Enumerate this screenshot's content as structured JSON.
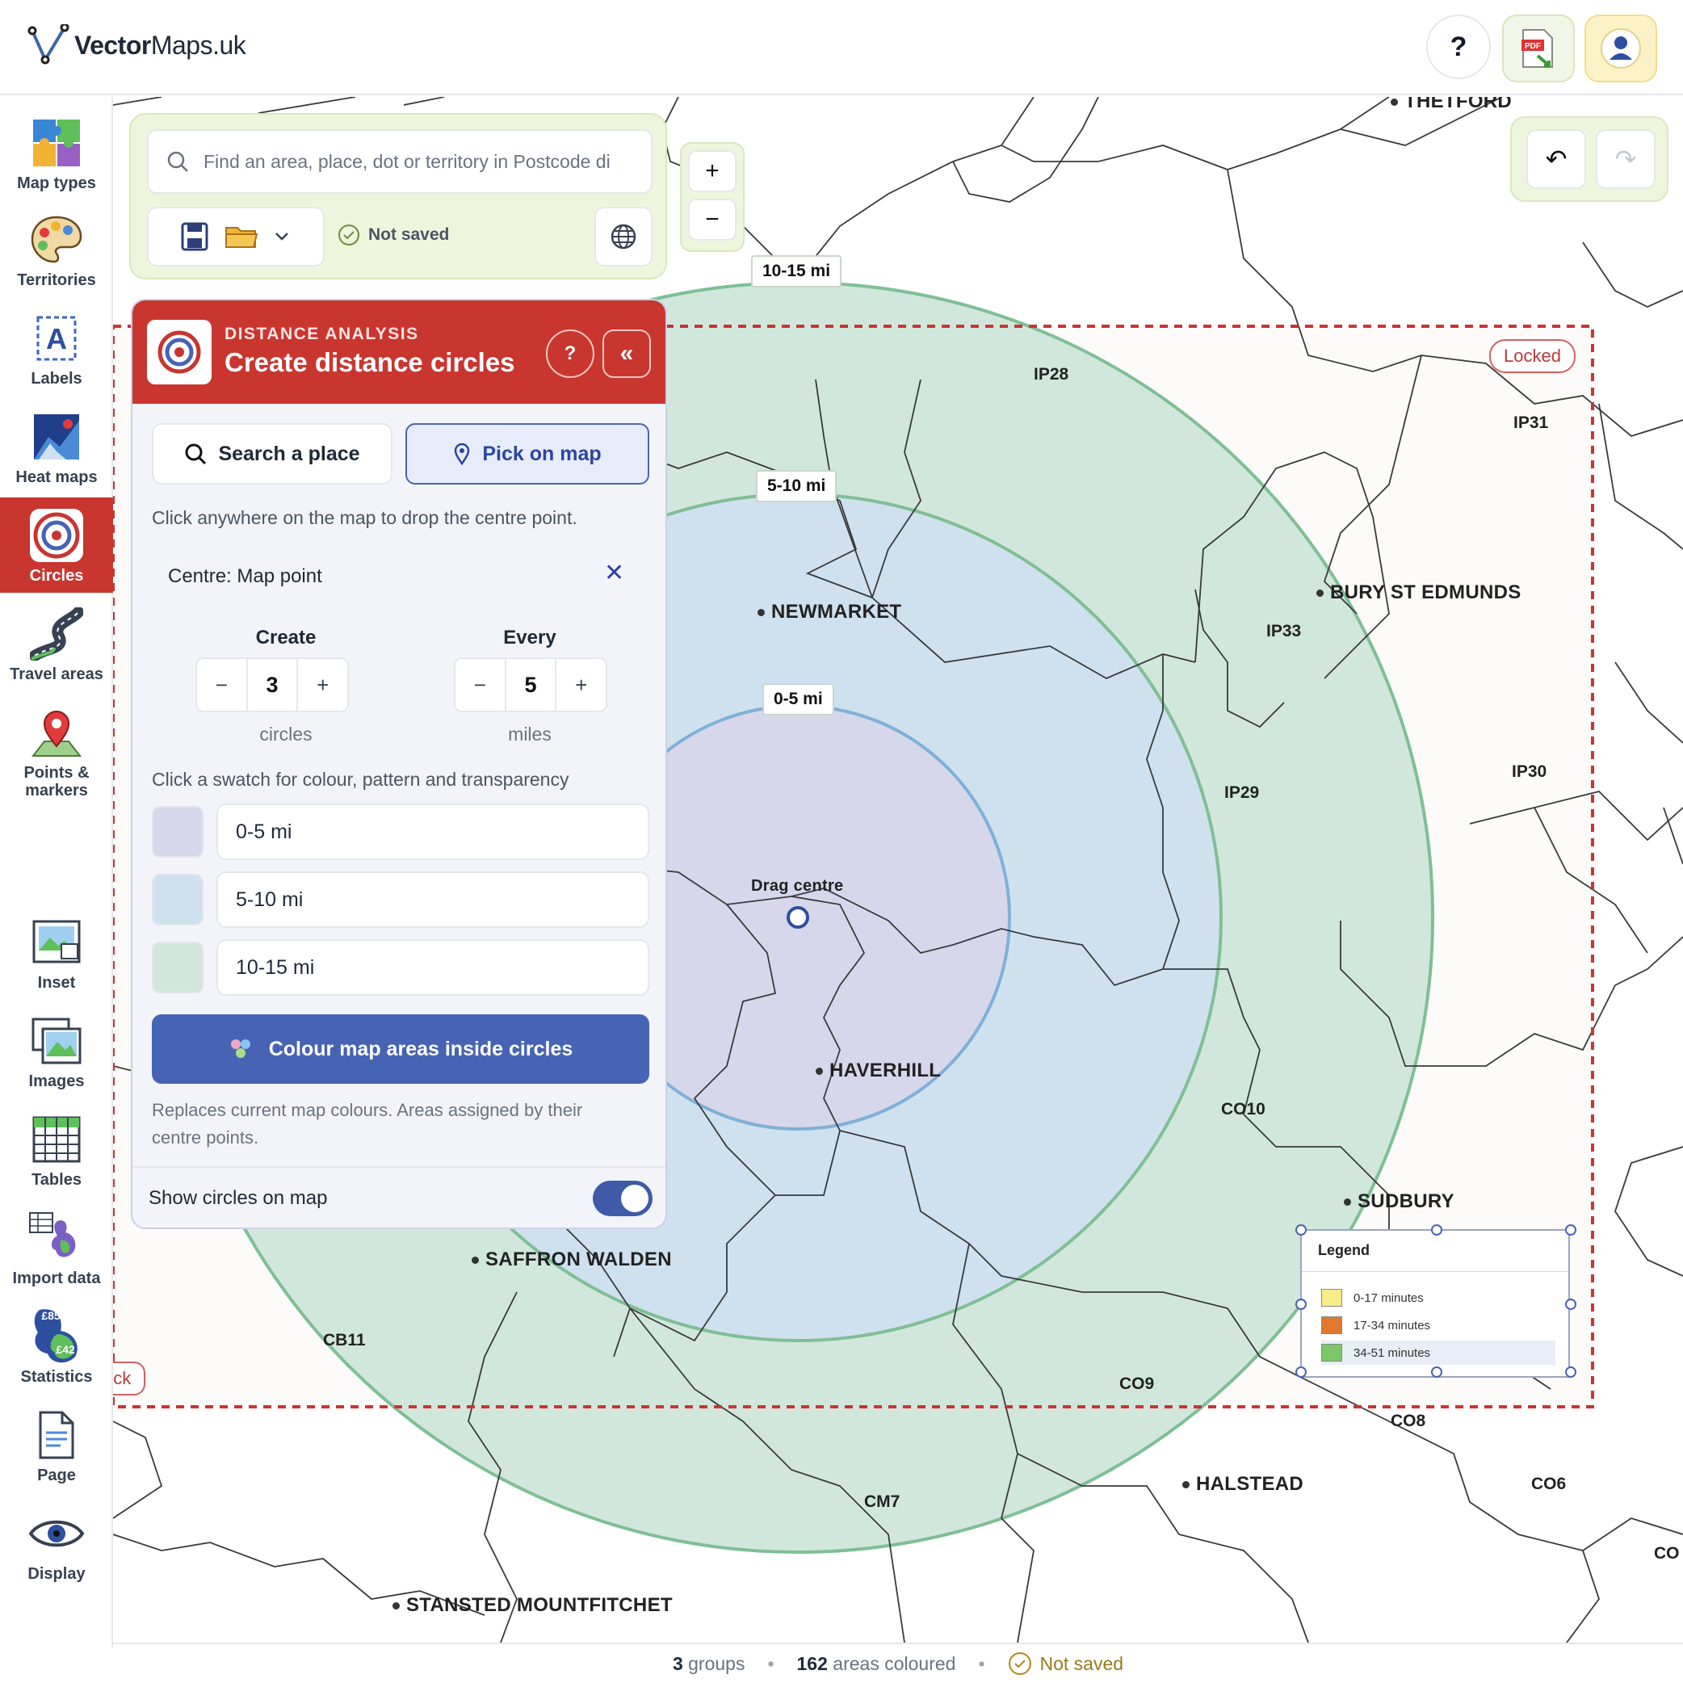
{
  "app": {
    "logo_text_bold": "Vector",
    "logo_text_rest": "Maps.uk",
    "help": "?"
  },
  "sidebar": {
    "items": [
      {
        "label": "Map types",
        "icon": "puzzle-icon"
      },
      {
        "label": "Territories",
        "icon": "palette-icon"
      },
      {
        "label": "Labels",
        "icon": "label-a-icon"
      },
      {
        "label": "Heat maps",
        "icon": "heat-map-icon"
      },
      {
        "label": "Circles",
        "icon": "target-icon",
        "active": true
      },
      {
        "label": "Travel areas",
        "icon": "road-icon"
      },
      {
        "label": "Points &",
        "label2": "markers",
        "icon": "map-pin-icon"
      },
      {
        "label": "Inset",
        "icon": "inset-icon"
      },
      {
        "label": "Images",
        "icon": "images-icon"
      },
      {
        "label": "Tables",
        "icon": "table-icon"
      },
      {
        "label": "Import data",
        "icon": "import-icon"
      },
      {
        "label": "Statistics",
        "icon": "statistics-icon",
        "badge1": "£85",
        "badge2": "£42"
      },
      {
        "label": "Page",
        "icon": "page-icon"
      },
      {
        "label": "Display",
        "icon": "eye-icon"
      }
    ]
  },
  "search": {
    "placeholder": "Find an area, place, dot or territory in Postcode di",
    "status": "Not saved"
  },
  "zoom": {
    "in": "+",
    "out": "−"
  },
  "history": {
    "undo": "↶",
    "redo": "↷"
  },
  "panel": {
    "kicker": "DISTANCE ANALYSIS",
    "title": "Create distance circles",
    "help": "?",
    "collapse": "«",
    "mode_search": "Search a place",
    "mode_pick": "Pick on map",
    "hint": "Click anywhere on the map to drop the centre point.",
    "centre": "Centre: Map point",
    "create_label": "Create",
    "create_value": "3",
    "create_unit": "circles",
    "every_label": "Every",
    "every_value": "5",
    "every_unit": "miles",
    "minus": "−",
    "plus": "+",
    "swatch_hint": "Click a swatch for colour, pattern and transparency",
    "rings": [
      {
        "label": "0-5 mi",
        "color": "#d7d7ec"
      },
      {
        "label": "5-10 mi",
        "color": "#cfe1ef"
      },
      {
        "label": "10-15 mi",
        "color": "#d2e7dc"
      }
    ],
    "colour_button": "Colour map areas inside circles",
    "replace_note": "Replaces current map colours. Areas assigned by their centre points.",
    "show_circles": "Show circles on map",
    "show_circles_on": true
  },
  "map": {
    "ring_labels": [
      "10-15 mi",
      "5-10 mi",
      "0-5 mi"
    ],
    "drag_centre": "Drag centre",
    "locked": "Locked",
    "lock_partial": "ock",
    "places": [
      {
        "name": "NEWMARKET",
        "dot": true
      },
      {
        "name": "HAVERHILL",
        "dot": true
      },
      {
        "name": "SAFFRON WALDEN",
        "dot": true
      },
      {
        "name": "BURY ST EDMUNDS",
        "dot": true
      },
      {
        "name": "SUDBURY",
        "dot": true
      },
      {
        "name": "HALSTEAD",
        "dot": true
      },
      {
        "name": "STANSTED MOUNTFITCHET",
        "dot": true
      },
      {
        "name": "THETFORD",
        "dot": true
      }
    ],
    "postcodes": [
      "IP28",
      "IP31",
      "IP33",
      "IP30",
      "IP29",
      "CO10",
      "CB11",
      "CO9",
      "CO8",
      "CM7",
      "CO6",
      "CO"
    ]
  },
  "legend": {
    "title": "Legend",
    "items": [
      {
        "label": "0-17 minutes",
        "color": "#f7ec8a"
      },
      {
        "label": "17-34 minutes",
        "color": "#e0782f"
      },
      {
        "label": "34-51 minutes",
        "color": "#7dc768"
      }
    ]
  },
  "footer": {
    "groups_count": "3",
    "groups_label": "groups",
    "areas_count": "162",
    "areas_label": "areas coloured",
    "status": "Not saved"
  },
  "colors": {
    "accent_red": "#c8362f",
    "accent_blue": "#4763b4",
    "panel_green": "#eef5dd"
  }
}
